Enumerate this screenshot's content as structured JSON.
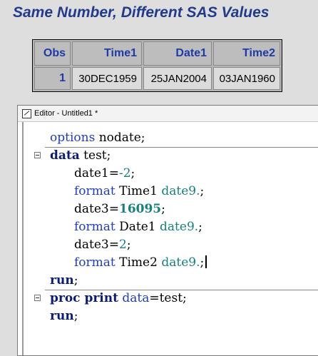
{
  "title": "Same Number, Different SAS Values",
  "table": {
    "headers": [
      "Obs",
      "Time1",
      "Date1",
      "Time2"
    ],
    "rows": [
      [
        "1",
        "30DEC1959",
        "25JAN2004",
        "03JAN1960"
      ]
    ]
  },
  "editor": {
    "window_title": "Editor - Untitled1 *",
    "lines": {
      "l1": {
        "kw": "options",
        "rest": " nodate;"
      },
      "l2": {
        "kw": "data",
        "rest": " test;"
      },
      "l3": {
        "a": "date1=",
        "b": "-2",
        "c": ";"
      },
      "l4": {
        "kw": "format",
        "var": " Time1 ",
        "fmt": "date9.",
        "end": ";"
      },
      "l5": {
        "a": "date3=",
        "b": "16095",
        "c": ";"
      },
      "l6": {
        "kw": "format",
        "var": " Date1 ",
        "fmt": "date9.",
        "end": ";"
      },
      "l7": {
        "a": "date3=",
        "b": "2",
        "c": ";"
      },
      "l8": {
        "kw": "format",
        "var": " Time2 ",
        "fmt": "date9.",
        "end": ";"
      },
      "l9": {
        "kw": "run",
        "end": ";"
      },
      "l10": {
        "kw": "proc print",
        "opt": " data",
        "rest": "=test;"
      },
      "l11": {
        "kw": "run",
        "end": ";"
      }
    }
  },
  "colors": {
    "title": "#213a8c",
    "keyword": "#0a1c78",
    "statement": "#1f3cc7",
    "format": "#178080"
  }
}
